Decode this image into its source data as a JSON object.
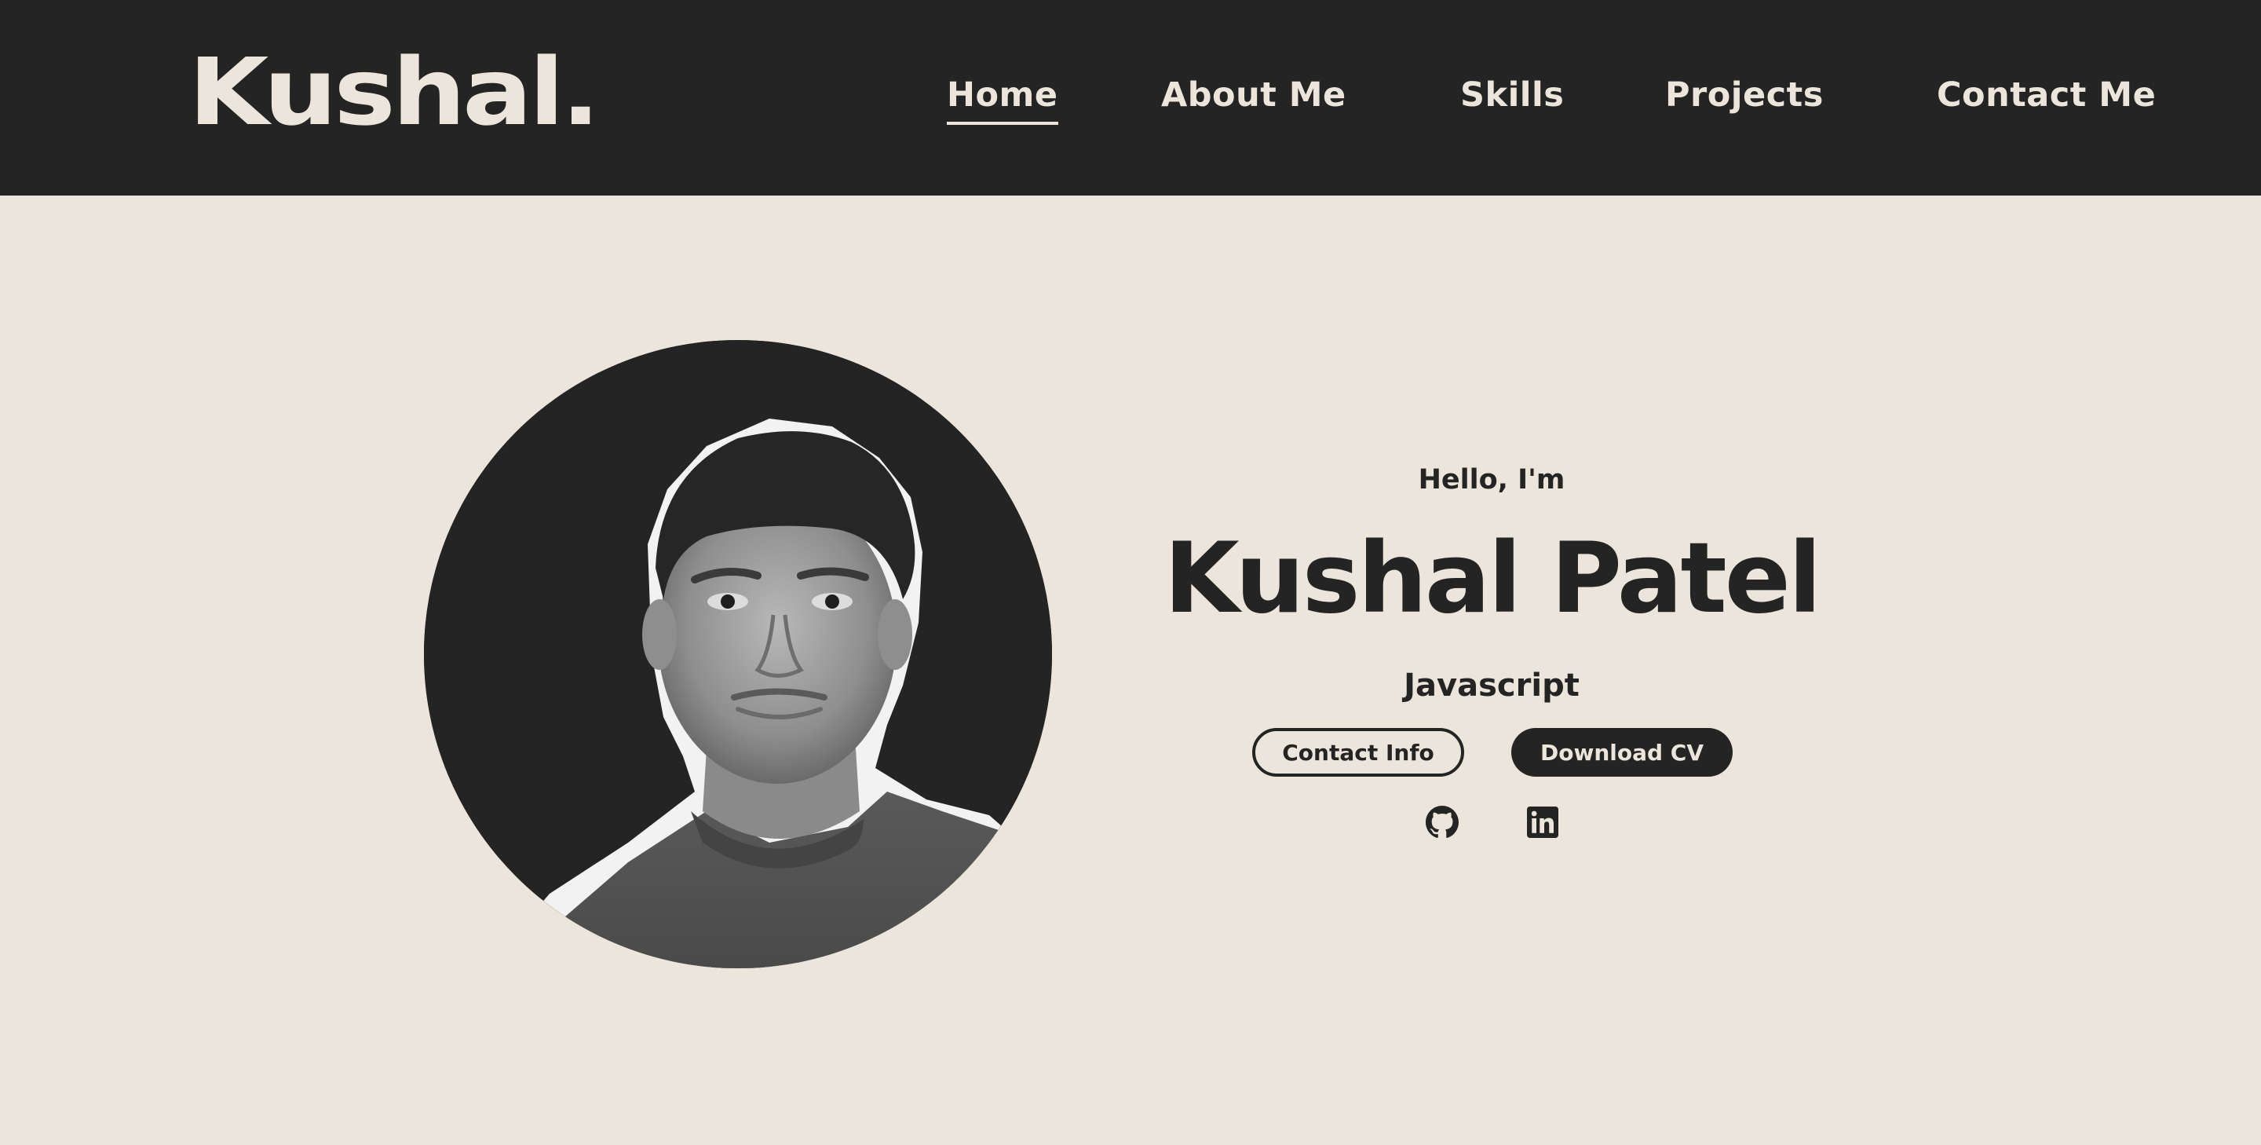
{
  "header": {
    "logo": "Kushal.",
    "nav": [
      {
        "label": "Home",
        "active": true
      },
      {
        "label": "About Me",
        "active": false
      },
      {
        "label": "Skills",
        "active": false
      },
      {
        "label": "Projects",
        "active": false
      },
      {
        "label": "Contact Me",
        "active": false
      }
    ]
  },
  "hero": {
    "greeting": "Hello, I'm",
    "name": "Kushal Patel",
    "role": "Javascript",
    "buttons": {
      "contact": "Contact Info",
      "download": "Download CV"
    },
    "social": [
      {
        "icon": "github-icon"
      },
      {
        "icon": "linkedin-icon"
      }
    ]
  },
  "colors": {
    "dark": "#242424",
    "light": "#ebe5dc"
  }
}
